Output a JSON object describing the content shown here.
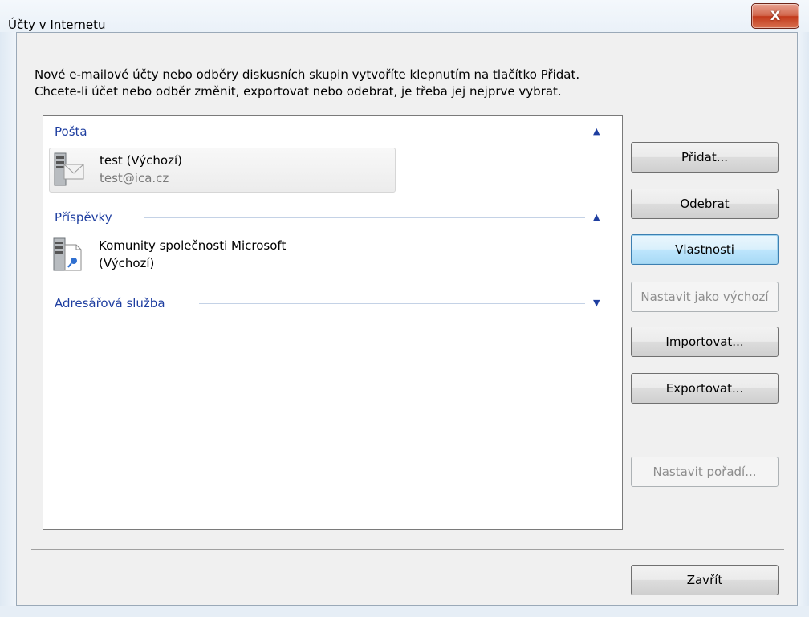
{
  "window": {
    "title": "Účty v Internetu",
    "close_glyph": "X"
  },
  "description": {
    "line1": "Nové e-mailové účty nebo odběry diskusních skupin vytvoříte klepnutím na tlačítko Přidat.",
    "line2": "Chcete-li účet nebo odběr změnit, exportovat nebo odebrat, je třeba jej nejprve vybrat."
  },
  "groups": {
    "mail": {
      "label": "Pošta",
      "expanded": true,
      "accounts": [
        {
          "name": "test (Výchozí)",
          "sub": "test@ica.cz",
          "selected": true,
          "icon": "mail-account-icon"
        }
      ]
    },
    "news": {
      "label": "Příspěvky",
      "expanded": true,
      "accounts": [
        {
          "name": "Komunity společnosti Microsoft",
          "sub": "(Výchozí)",
          "selected": false,
          "icon": "news-account-icon"
        }
      ]
    },
    "directory": {
      "label": "Adresářová služba",
      "expanded": false
    }
  },
  "buttons": {
    "add": "Přidat...",
    "remove": "Odebrat",
    "properties": "Vlastnosti",
    "set_default": "Nastavit jako výchozí",
    "import": "Importovat...",
    "export": "Exportovat...",
    "set_order": "Nastavit pořadí...",
    "close": "Zavřít"
  },
  "icons": {
    "collapse": "chevron-up-icon",
    "expand": "chevron-down-icon"
  },
  "colors": {
    "group_header": "#1e3ea0",
    "focus_border": "#3c7fb1",
    "disabled_text": "#8d8d8d"
  }
}
